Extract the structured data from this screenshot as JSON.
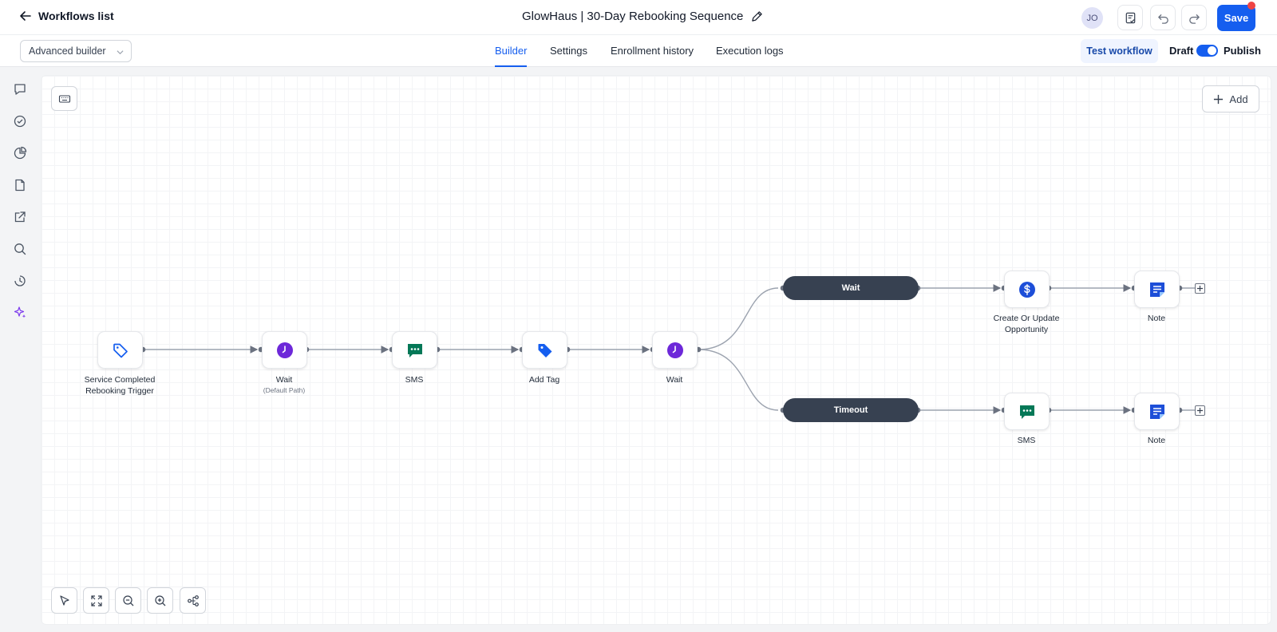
{
  "header": {
    "back_label": "Workflows list",
    "workflow_title": "GlowHaus | 30-Day Rebooking Sequence",
    "avatar_initials": "JO",
    "save_label": "Save"
  },
  "subbar": {
    "builder_mode": "Advanced builder",
    "tabs": [
      {
        "label": "Builder",
        "active": true
      },
      {
        "label": "Settings",
        "active": false
      },
      {
        "label": "Enrollment history",
        "active": false
      },
      {
        "label": "Execution logs",
        "active": false
      }
    ],
    "test_workflow_label": "Test workflow",
    "draft_label": "Draft",
    "publish_label": "Publish",
    "published": true
  },
  "canvas": {
    "add_label": "Add",
    "nodes": [
      {
        "id": "trigger",
        "icon": "tag-outline-icon",
        "label_lines": [
          "Service Completed",
          "Rebooking Trigger"
        ]
      },
      {
        "id": "wait-1",
        "icon": "clock-icon",
        "label_lines": [
          "Wait"
        ],
        "sub": "(Default Path)"
      },
      {
        "id": "sms-1",
        "icon": "sms-icon",
        "label_lines": [
          "SMS"
        ]
      },
      {
        "id": "add-tag",
        "icon": "tag-filled-icon",
        "label_lines": [
          "Add Tag"
        ]
      },
      {
        "id": "wait-2",
        "icon": "clock-icon",
        "label_lines": [
          "Wait"
        ]
      },
      {
        "id": "opportunity",
        "icon": "dollar-icon",
        "label_lines": [
          "Create Or Update",
          "Opportunity"
        ]
      },
      {
        "id": "note-1",
        "icon": "note-icon",
        "label_lines": [
          "Note"
        ]
      },
      {
        "id": "sms-2",
        "icon": "sms-icon",
        "label_lines": [
          "SMS"
        ]
      },
      {
        "id": "note-2",
        "icon": "note-icon",
        "label_lines": [
          "Note"
        ]
      }
    ],
    "branches": [
      {
        "label": "Wait"
      },
      {
        "label": "Timeout"
      }
    ]
  },
  "colors": {
    "primary": "#155eef",
    "branch_pill": "#374151",
    "wait_icon": "#6d28d9",
    "sms_icon": "#047857",
    "tag_icon": "#155eef",
    "note_icon": "#1d4ed8",
    "notification_dot": "#ef4444"
  }
}
